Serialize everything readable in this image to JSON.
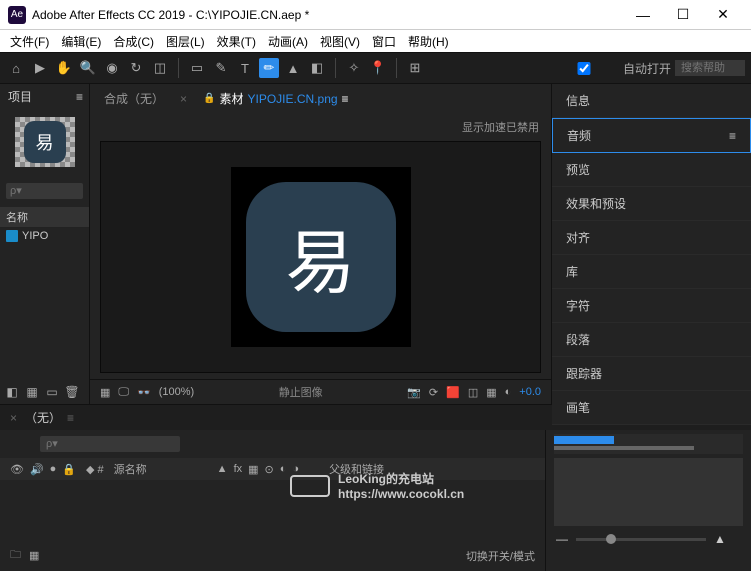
{
  "titlebar": {
    "app_prefix": "Ae",
    "title": "Adobe After Effects CC 2019 - C:\\YIPOJIE.CN.aep *"
  },
  "menubar": {
    "file": "文件(F)",
    "edit": "编辑(E)",
    "comp": "合成(C)",
    "layer": "图层(L)",
    "effect": "效果(T)",
    "anim": "动画(A)",
    "view": "视图(V)",
    "window": "窗口",
    "help": "帮助(H)"
  },
  "toolbar": {
    "auto_open": "自动打开",
    "search_placeholder": "搜索帮助"
  },
  "project": {
    "title": "项目",
    "thumb_char": "易",
    "name_header": "名称",
    "item_name": "YIPO"
  },
  "center": {
    "tab1": "合成（无）",
    "tab2_prefix": "素材",
    "tab2_file": "YIPOJIE.CN.png",
    "notice": "显示加速已禁用",
    "viewer_char": "易",
    "zoom": "(100%)",
    "still": "静止图像",
    "offset": "+0.0"
  },
  "right": {
    "info": "信息",
    "audio": "音频",
    "preview": "预览",
    "effects": "效果和预设",
    "align": "对齐",
    "library": "库",
    "char": "字符",
    "para": "段落",
    "tracker": "跟踪器",
    "brush": "画笔"
  },
  "timeline": {
    "tab": "（无）",
    "source_name": "源名称",
    "parent": "父级和链接",
    "toggle": "切换开关/模式"
  },
  "watermark": {
    "line1": "LeoKing的充电站",
    "line2": "https://www.cocokl.cn"
  }
}
